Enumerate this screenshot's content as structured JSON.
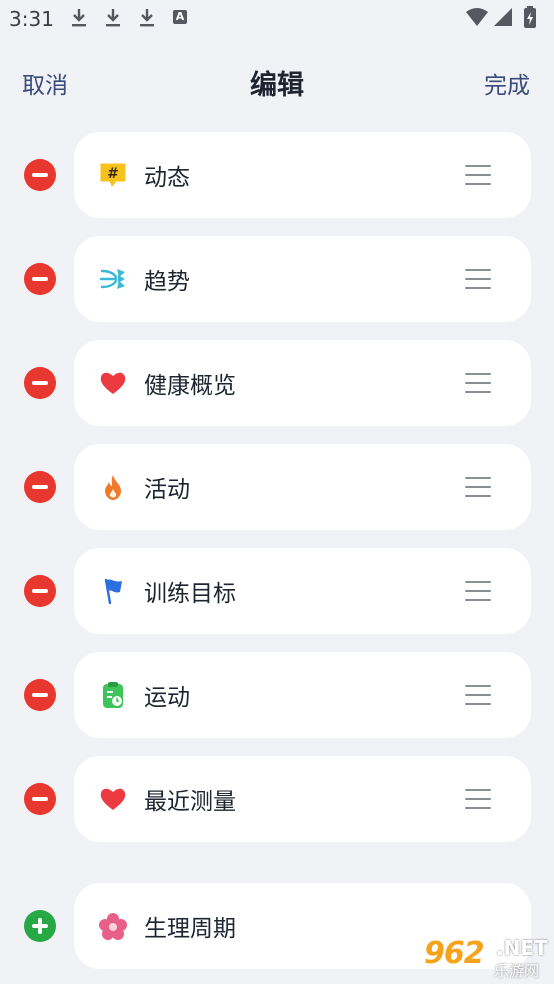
{
  "status_bar": {
    "time": "3:31",
    "notification_icons": [
      "download-icon",
      "download-icon",
      "download-icon",
      "a-icon"
    ],
    "a_label": "A",
    "right_icons": [
      "wifi-icon",
      "signal-icon",
      "battery-charging-icon"
    ]
  },
  "nav": {
    "cancel_label": "取消",
    "title": "编辑",
    "done_label": "完成"
  },
  "items": [
    {
      "label": "动态",
      "icon": "hashtag-icon",
      "action": "remove",
      "icon_color": "#f7c21c"
    },
    {
      "label": "趋势",
      "icon": "trend-arrows-icon",
      "action": "remove",
      "icon_color": "#3bb8d8"
    },
    {
      "label": "健康概览",
      "icon": "heart-icon",
      "action": "remove",
      "icon_color": "#ec3a43"
    },
    {
      "label": "活动",
      "icon": "flame-icon",
      "action": "remove",
      "icon_color": "#f07a2c"
    },
    {
      "label": "训练目标",
      "icon": "flag-icon",
      "action": "remove",
      "icon_color": "#2e6fe0"
    },
    {
      "label": "运动",
      "icon": "clipboard-icon",
      "action": "remove",
      "icon_color": "#3ec45a"
    },
    {
      "label": "最近测量",
      "icon": "heart-icon",
      "action": "remove",
      "icon_color": "#ec3a43"
    },
    {
      "label": "生理周期",
      "icon": "flower-icon",
      "action": "add",
      "icon_color": "#e8608a"
    }
  ],
  "colors": {
    "remove": "#e8372f",
    "add": "#26a845",
    "nav_text": "#3a4a7a",
    "background": "#f1f2f6"
  },
  "watermark": {
    "brand": "962",
    "net": ".NET",
    "sub": "乐游网"
  }
}
